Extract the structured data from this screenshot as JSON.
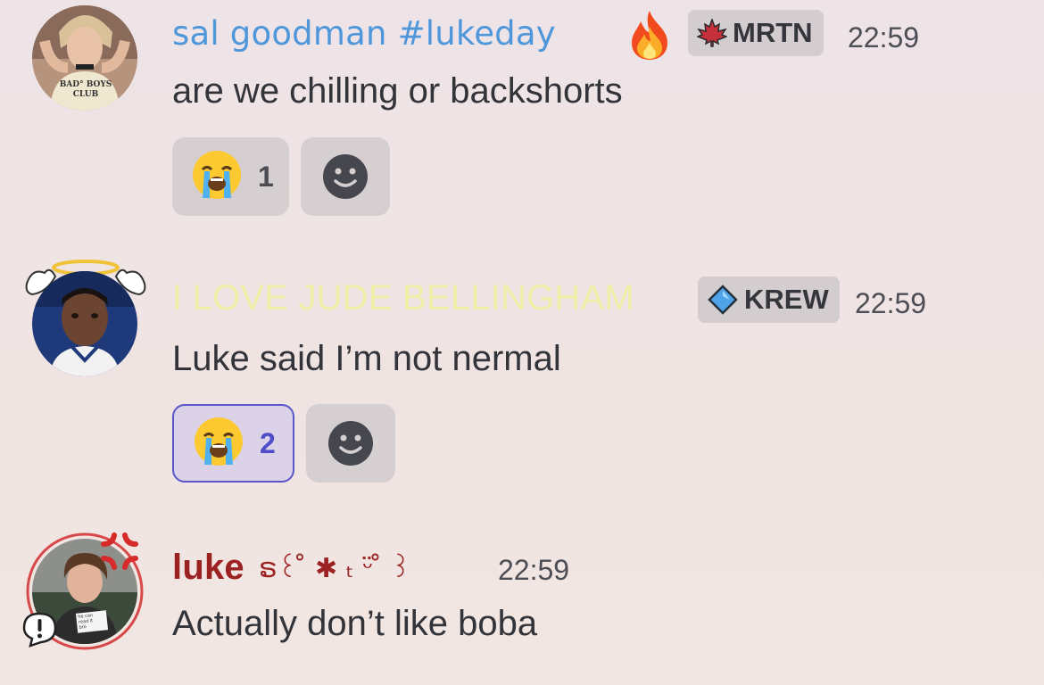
{
  "messages": [
    {
      "author": "sal goodman #lukeday",
      "author_color": "#4e97db",
      "author_emoji": "🔥",
      "badge_icon": "maple-leaf-icon",
      "badge": "MRTN",
      "time": "22:59",
      "text": "are we chilling or backshorts",
      "avatar_shirt_text": [
        "BAD° BOYS",
        "CLUB"
      ],
      "reactions": [
        {
          "emoji": "loudly-crying-face",
          "count": "1",
          "active": false
        }
      ]
    },
    {
      "author": "I LOVE JUDE BELLINGHAM",
      "author_color": "#f0efa8",
      "badge_icon": "water-drop-icon",
      "badge": "KREW",
      "time": "22:59",
      "text": "Luke said I’m not nermal",
      "reactions": [
        {
          "emoji": "loudly-crying-face",
          "count": "2",
          "active": true
        }
      ]
    },
    {
      "author": "luke",
      "author_color": "#9c2222",
      "author_suffix": "ຣ꒰ ̊ ✱ ₜ ᵕ̈ ̊ ꒱",
      "time": "22:59",
      "text": "Actually don’t like boba",
      "avatar_decoration": "anger-symbol-icon",
      "avatar_sign_text": [
        "he can",
        "read it",
        "bro"
      ]
    }
  ],
  "colors": {
    "reaction_active_border": "#5a57c8",
    "reaction_active_text": "#4f4cc7",
    "badge_bg": "#d3cdd0"
  }
}
